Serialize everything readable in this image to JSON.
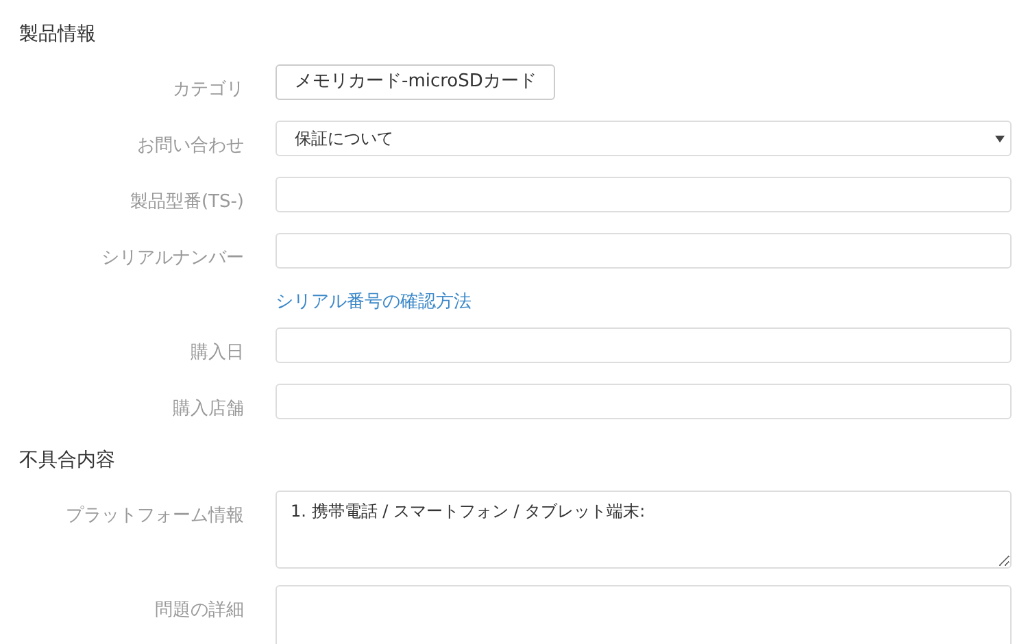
{
  "sections": [
    {
      "title": "製品情報",
      "rows": [
        {
          "kind": "static",
          "label": "カテゴリ",
          "value": "メモリカード-microSDカード"
        },
        {
          "kind": "select",
          "label": "お問い合わせ",
          "value": "保証について"
        },
        {
          "kind": "input",
          "label": "製品型番(TS-)"
        },
        {
          "kind": "input",
          "label": "シリアルナンバー"
        },
        {
          "kind": "link",
          "text": "シリアル番号の確認方法"
        },
        {
          "kind": "input",
          "label": "購入日"
        },
        {
          "kind": "input",
          "label": "購入店舗"
        }
      ]
    },
    {
      "title": "不具合内容",
      "rows": [
        {
          "kind": "textarea",
          "label": "プラットフォーム情報",
          "value": "1. 携帯電話 / スマートフォン / タブレット端末:"
        },
        {
          "kind": "textarea",
          "label": "問題の詳細"
        }
      ]
    }
  ]
}
